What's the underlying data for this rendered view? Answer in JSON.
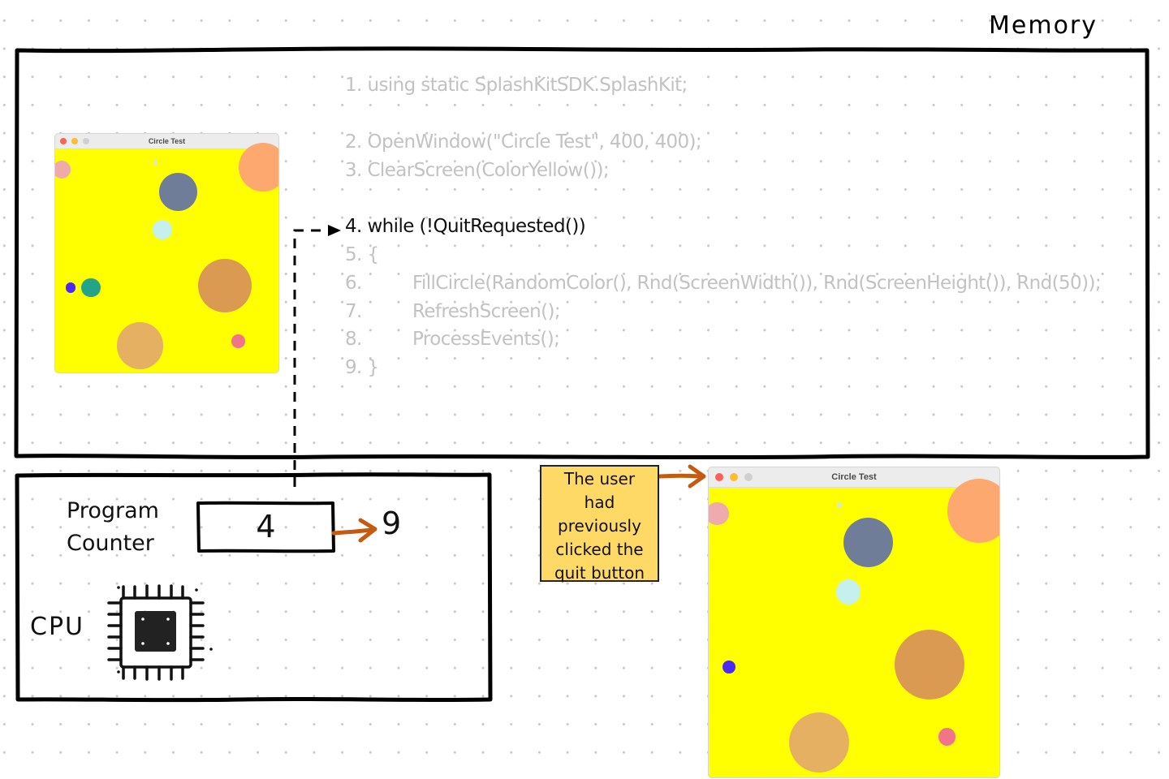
{
  "memory": {
    "title": "Memory",
    "code_lines": [
      {
        "num": "1.",
        "text": "using static SplashKitSDK.SplashKit;",
        "active": false
      },
      {
        "num": "2.",
        "text": "OpenWindow(\"Circle Test\", 400, 400);",
        "active": false
      },
      {
        "num": "3.",
        "text": "ClearScreen(ColorYellow());",
        "active": false
      },
      {
        "num": "4.",
        "text": "while (!QuitRequested())",
        "active": true
      },
      {
        "num": "5.",
        "text": "{",
        "active": false
      },
      {
        "num": "6.",
        "text": "FillCircle(RandomColor(), Rnd(ScreenWidth()), Rnd(ScreenHeight()), Rnd(50));",
        "active": false
      },
      {
        "num": "7.",
        "text": "RefreshScreen();",
        "active": false
      },
      {
        "num": "8.",
        "text": "ProcessEvents();",
        "active": false
      },
      {
        "num": "9.",
        "text": "}",
        "active": false
      }
    ]
  },
  "window_small": {
    "title": "Circle Test",
    "background": "#ffff00"
  },
  "window_large": {
    "title": "Circle Test",
    "background": "#ffff00"
  },
  "circles": [
    {
      "color": "#eeaaad",
      "name": "pink-circle"
    },
    {
      "color": "#cfe8f0",
      "name": "tiny-lightblue-circle"
    },
    {
      "color": "#6f7d98",
      "name": "slate-circle"
    },
    {
      "color": "#fda86e",
      "name": "peach-circle"
    },
    {
      "color": "#c6f0ee",
      "name": "cyan-circle"
    },
    {
      "color": "#db9a52",
      "name": "brown-circle"
    },
    {
      "color": "#4a28f5",
      "name": "blue-circle"
    },
    {
      "color": "#22a38a",
      "name": "teal-circle"
    },
    {
      "color": "#e6b062",
      "name": "tan-circle"
    },
    {
      "color": "#f07589",
      "name": "rose-circle"
    }
  ],
  "traffic_lights": {
    "close": "#fe5f57",
    "minimize": "#febc2e",
    "maximize": "#d0d0d0"
  },
  "cpu": {
    "program_counter_label_1": "Program",
    "program_counter_label_2": "Counter",
    "program_counter_value": "4",
    "next_value": "9",
    "cpu_label": "CPU"
  },
  "note": {
    "lines": [
      "The user",
      "had",
      "previously",
      "clicked the",
      "quit button"
    ],
    "background": "#ffd966"
  },
  "colors": {
    "arrow_orange": "#c55a11",
    "inactive_code": "#c2c2c2",
    "active_code": "#111111"
  }
}
